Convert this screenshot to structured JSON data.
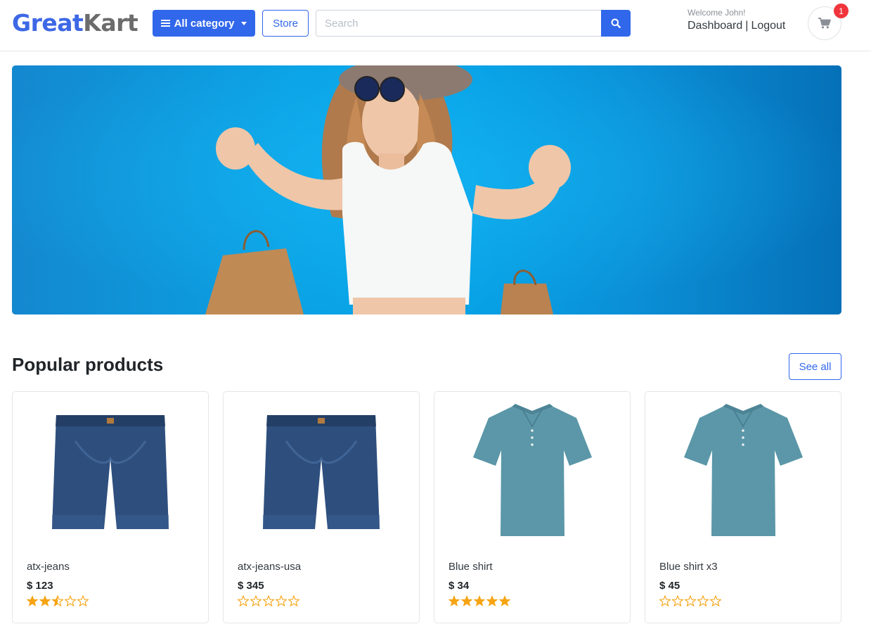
{
  "header": {
    "logo_part1": "Great",
    "logo_part2": "Kart",
    "category_button": "All category",
    "store_button": "Store",
    "search_placeholder": "Search",
    "welcome_text": "Welcome John!",
    "dashboard_link": "Dashboard",
    "separator": "|",
    "logout_link": "Logout",
    "cart_count": "1"
  },
  "section": {
    "title": "Popular products",
    "see_all": "See all"
  },
  "products": [
    {
      "name": "atx-jeans",
      "price": "$ 123",
      "rating": 2.5,
      "image": "jeans-shorts"
    },
    {
      "name": "atx-jeans-usa",
      "price": "$ 345",
      "rating": 0,
      "image": "jeans-shorts"
    },
    {
      "name": "Blue shirt",
      "price": "$ 34",
      "rating": 5,
      "image": "polo-shirt"
    },
    {
      "name": "Blue shirt x3",
      "price": "$ 45",
      "rating": 0,
      "image": "polo-shirt"
    }
  ],
  "colors": {
    "brand_blue": "#3167eb",
    "logo_gray": "#6c6c6c",
    "star": "#f6a414",
    "badge_red": "#f0343c",
    "banner_blue": "#06a6ea"
  }
}
